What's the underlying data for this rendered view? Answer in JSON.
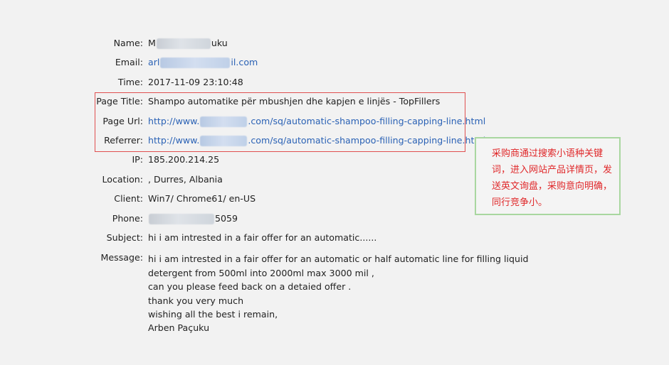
{
  "fields": {
    "name": {
      "label": "Name:",
      "prefix": "M",
      "suffix": "uku"
    },
    "email": {
      "label": "Email:",
      "prefix": "arl",
      "suffix": "il.com"
    },
    "time": {
      "label": "Time:",
      "value": "2017-11-09 23:10:48"
    },
    "page_title": {
      "label": "Page Title:",
      "value": "Shampo automatike për mbushjen dhe kapjen e linjës - TopFillers"
    },
    "page_url": {
      "label": "Page Url:",
      "prefix": "http://www.",
      "suffix": ".com/sq/automatic-shampoo-filling-capping-line.html"
    },
    "referrer": {
      "label": "Referrer:",
      "prefix": "http://www.",
      "suffix": ".com/sq/automatic-shampoo-filling-capping-line.html"
    },
    "ip": {
      "label": "IP:",
      "value": "185.200.214.25"
    },
    "location": {
      "label": "Location:",
      "value": ", Durres, Albania"
    },
    "client": {
      "label": "Client:",
      "value": "Win7/ Chrome61/ en-US"
    },
    "phone": {
      "label": "Phone:",
      "suffix": "5059"
    },
    "subject": {
      "label": "Subject:",
      "value": "hi i am intrested in a fair offer for an automatic......"
    },
    "message": {
      "label": "Message:",
      "value": "hi i am intrested in a fair offer for an automatic or half automatic line for filling liquid\ndetergent from 500ml into 2000ml max 3000 mil ,\ncan you please feed back on a detaied offer .\nthank you very much\nwishing all the best i remain,\nArben Paçuku"
    }
  },
  "annotation": {
    "text": "采购商通过搜索小语种关键词，进入网站产品详情页，发送英文询盘，采购意向明确，同行竞争小。"
  },
  "colors": {
    "background": "#f2f2f2",
    "link": "#2b62b5",
    "highlight_border": "#e05050",
    "note_border": "#a9d7a0",
    "note_text": "#e0282a"
  }
}
